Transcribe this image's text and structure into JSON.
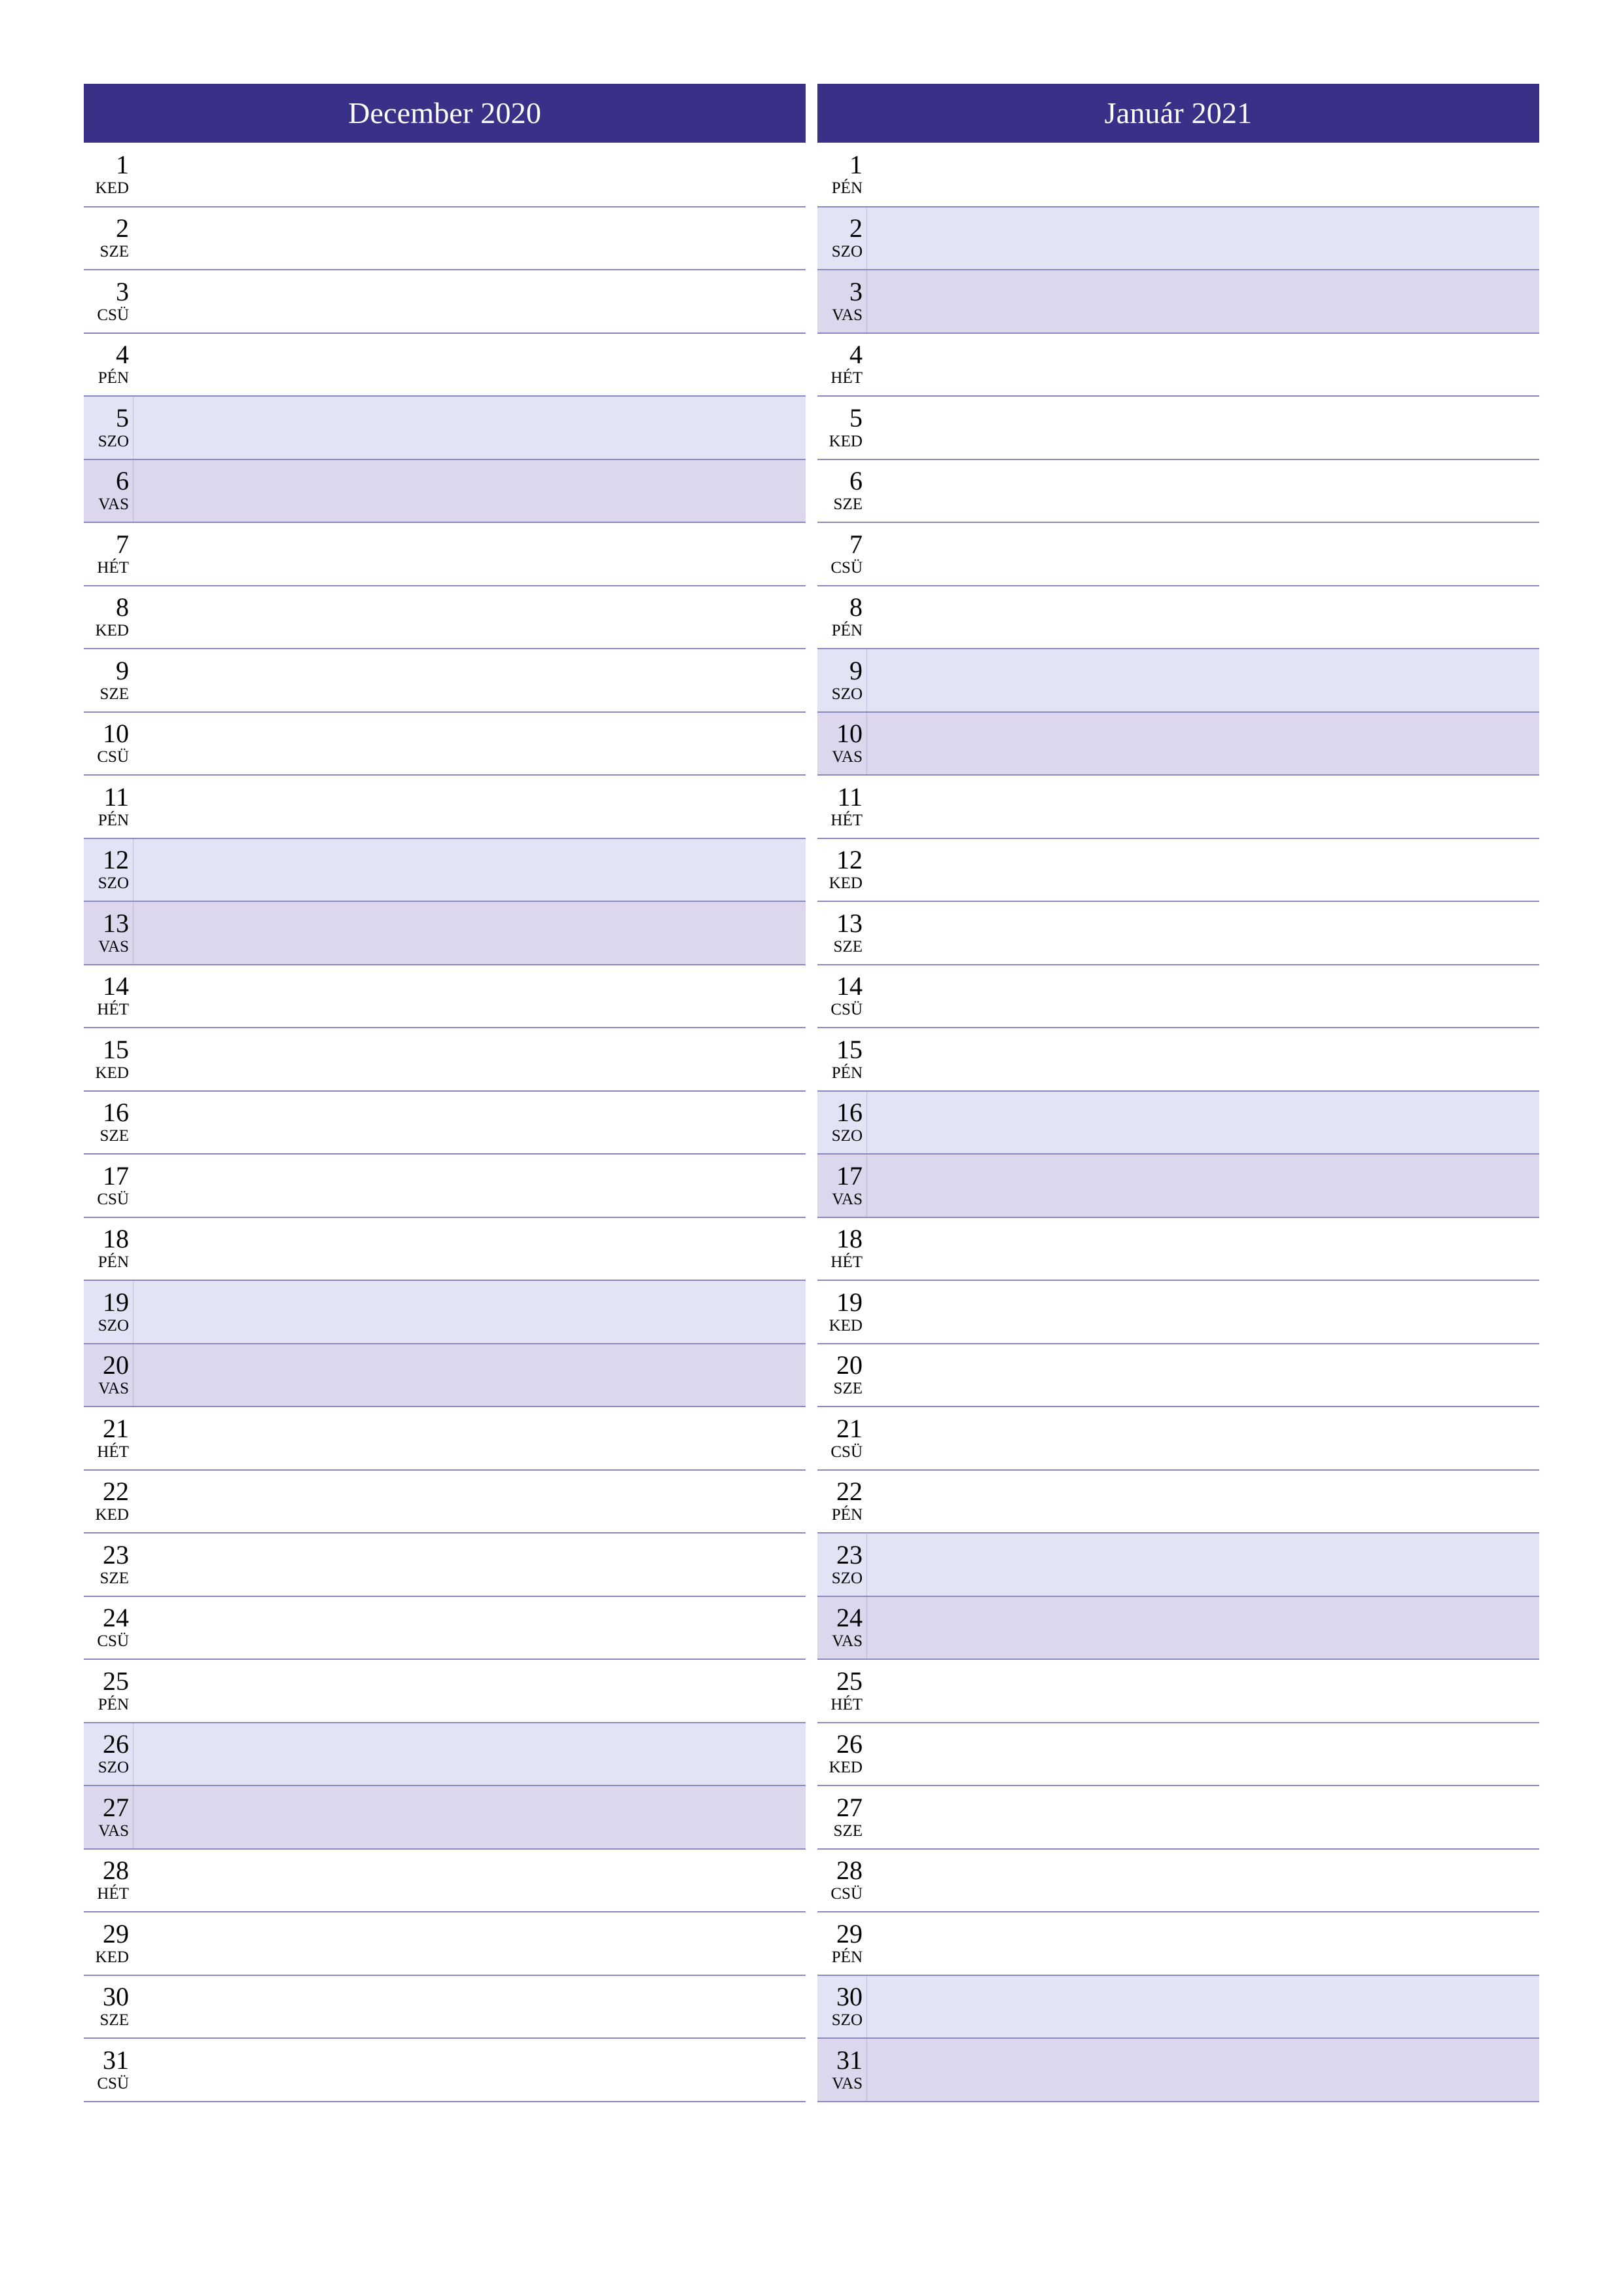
{
  "page": {
    "type": "monthly-planner",
    "language": "hu",
    "background_color": "#ffffff",
    "accent_color": "#3a3088",
    "separator_color": "#8b88c0",
    "saturday_color": "#e3e3f6",
    "sunday_color": "#dcd7ec"
  },
  "months": [
    {
      "title": "December 2020",
      "days": [
        {
          "number": "1",
          "name": "KED",
          "kind": "weekday"
        },
        {
          "number": "2",
          "name": "SZE",
          "kind": "weekday"
        },
        {
          "number": "3",
          "name": "CSÜ",
          "kind": "weekday"
        },
        {
          "number": "4",
          "name": "PÉN",
          "kind": "weekday"
        },
        {
          "number": "5",
          "name": "SZO",
          "kind": "saturday"
        },
        {
          "number": "6",
          "name": "VAS",
          "kind": "sunday"
        },
        {
          "number": "7",
          "name": "HÉT",
          "kind": "weekday"
        },
        {
          "number": "8",
          "name": "KED",
          "kind": "weekday"
        },
        {
          "number": "9",
          "name": "SZE",
          "kind": "weekday"
        },
        {
          "number": "10",
          "name": "CSÜ",
          "kind": "weekday"
        },
        {
          "number": "11",
          "name": "PÉN",
          "kind": "weekday"
        },
        {
          "number": "12",
          "name": "SZO",
          "kind": "saturday"
        },
        {
          "number": "13",
          "name": "VAS",
          "kind": "sunday"
        },
        {
          "number": "14",
          "name": "HÉT",
          "kind": "weekday"
        },
        {
          "number": "15",
          "name": "KED",
          "kind": "weekday"
        },
        {
          "number": "16",
          "name": "SZE",
          "kind": "weekday"
        },
        {
          "number": "17",
          "name": "CSÜ",
          "kind": "weekday"
        },
        {
          "number": "18",
          "name": "PÉN",
          "kind": "weekday"
        },
        {
          "number": "19",
          "name": "SZO",
          "kind": "saturday"
        },
        {
          "number": "20",
          "name": "VAS",
          "kind": "sunday"
        },
        {
          "number": "21",
          "name": "HÉT",
          "kind": "weekday"
        },
        {
          "number": "22",
          "name": "KED",
          "kind": "weekday"
        },
        {
          "number": "23",
          "name": "SZE",
          "kind": "weekday"
        },
        {
          "number": "24",
          "name": "CSÜ",
          "kind": "weekday"
        },
        {
          "number": "25",
          "name": "PÉN",
          "kind": "weekday"
        },
        {
          "number": "26",
          "name": "SZO",
          "kind": "saturday"
        },
        {
          "number": "27",
          "name": "VAS",
          "kind": "sunday"
        },
        {
          "number": "28",
          "name": "HÉT",
          "kind": "weekday"
        },
        {
          "number": "29",
          "name": "KED",
          "kind": "weekday"
        },
        {
          "number": "30",
          "name": "SZE",
          "kind": "weekday"
        },
        {
          "number": "31",
          "name": "CSÜ",
          "kind": "weekday"
        }
      ]
    },
    {
      "title": "Január 2021",
      "days": [
        {
          "number": "1",
          "name": "PÉN",
          "kind": "weekday"
        },
        {
          "number": "2",
          "name": "SZO",
          "kind": "saturday"
        },
        {
          "number": "3",
          "name": "VAS",
          "kind": "sunday"
        },
        {
          "number": "4",
          "name": "HÉT",
          "kind": "weekday"
        },
        {
          "number": "5",
          "name": "KED",
          "kind": "weekday"
        },
        {
          "number": "6",
          "name": "SZE",
          "kind": "weekday"
        },
        {
          "number": "7",
          "name": "CSÜ",
          "kind": "weekday"
        },
        {
          "number": "8",
          "name": "PÉN",
          "kind": "weekday"
        },
        {
          "number": "9",
          "name": "SZO",
          "kind": "saturday"
        },
        {
          "number": "10",
          "name": "VAS",
          "kind": "sunday"
        },
        {
          "number": "11",
          "name": "HÉT",
          "kind": "weekday"
        },
        {
          "number": "12",
          "name": "KED",
          "kind": "weekday"
        },
        {
          "number": "13",
          "name": "SZE",
          "kind": "weekday"
        },
        {
          "number": "14",
          "name": "CSÜ",
          "kind": "weekday"
        },
        {
          "number": "15",
          "name": "PÉN",
          "kind": "weekday"
        },
        {
          "number": "16",
          "name": "SZO",
          "kind": "saturday"
        },
        {
          "number": "17",
          "name": "VAS",
          "kind": "sunday"
        },
        {
          "number": "18",
          "name": "HÉT",
          "kind": "weekday"
        },
        {
          "number": "19",
          "name": "KED",
          "kind": "weekday"
        },
        {
          "number": "20",
          "name": "SZE",
          "kind": "weekday"
        },
        {
          "number": "21",
          "name": "CSÜ",
          "kind": "weekday"
        },
        {
          "number": "22",
          "name": "PÉN",
          "kind": "weekday"
        },
        {
          "number": "23",
          "name": "SZO",
          "kind": "saturday"
        },
        {
          "number": "24",
          "name": "VAS",
          "kind": "sunday"
        },
        {
          "number": "25",
          "name": "HÉT",
          "kind": "weekday"
        },
        {
          "number": "26",
          "name": "KED",
          "kind": "weekday"
        },
        {
          "number": "27",
          "name": "SZE",
          "kind": "weekday"
        },
        {
          "number": "28",
          "name": "CSÜ",
          "kind": "weekday"
        },
        {
          "number": "29",
          "name": "PÉN",
          "kind": "weekday"
        },
        {
          "number": "30",
          "name": "SZO",
          "kind": "saturday"
        },
        {
          "number": "31",
          "name": "VAS",
          "kind": "sunday"
        }
      ]
    }
  ]
}
